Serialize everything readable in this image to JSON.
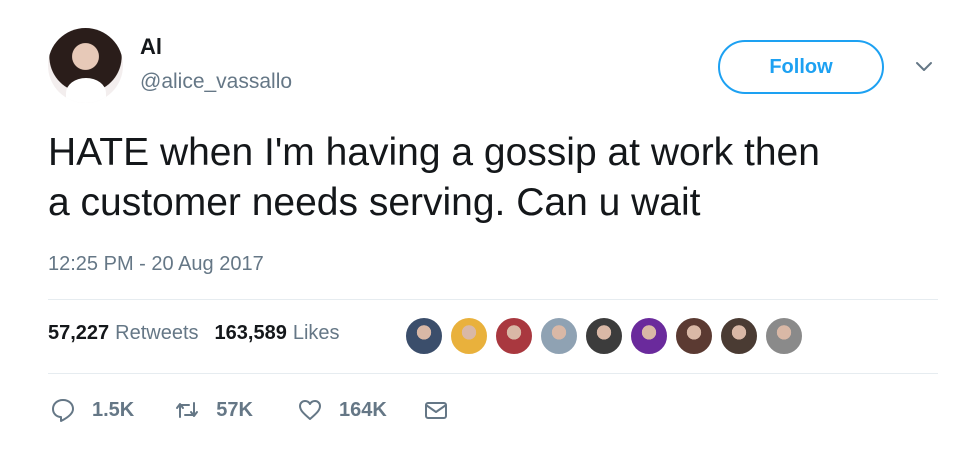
{
  "user": {
    "display_name": "Al",
    "handle": "@alice_vassallo"
  },
  "follow_label": "Follow",
  "tweet": {
    "lines": [
      "HATE when I'm having a gossip at work then",
      "a customer needs serving. Can u wait"
    ],
    "timestamp": "12:25 PM - 20 Aug 2017"
  },
  "stats": {
    "retweets_count": "57,227",
    "retweets_label": "Retweets",
    "likes_count": "163,589",
    "likes_label": "Likes"
  },
  "likers": [
    {
      "color": "#3b4e6b"
    },
    {
      "color": "#e9b13c"
    },
    {
      "color": "#a9383f"
    },
    {
      "color": "#8fa2b3"
    },
    {
      "color": "#3c3c3c"
    },
    {
      "color": "#6a2a9c"
    },
    {
      "color": "#5b3a32"
    },
    {
      "color": "#4a3b33"
    },
    {
      "color": "#8a8a8a"
    }
  ],
  "actions": {
    "replies": "1.5K",
    "retweets": "57K",
    "likes": "164K"
  },
  "icons": {
    "reply": "reply-icon",
    "retweet": "retweet-icon",
    "like": "heart-icon",
    "dm": "envelope-icon",
    "caret": "chevron-down-icon"
  },
  "colors": {
    "accent": "#1da1f2",
    "secondary_text": "#657786",
    "divider": "#e6ecf0"
  }
}
